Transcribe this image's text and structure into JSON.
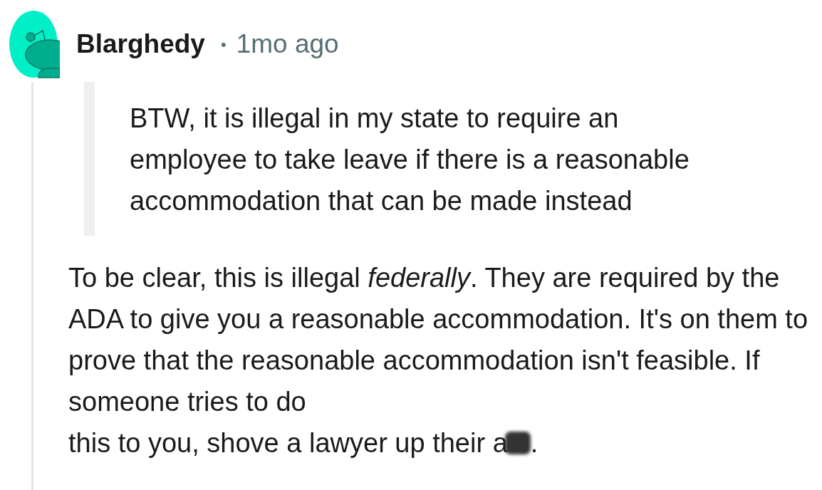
{
  "author": {
    "username": "Blarghedy",
    "separator": "•",
    "time": "1mo ago"
  },
  "quote": "BTW, it is illegal in my state to require an employee to take leave if there is a reasonable accommodation that can be made instead",
  "body": {
    "text": "To be clear, this is illegal *federally*. They are required by the ADA to give you a reasonable accommodation. It's on them to prove that the reasonable accommodation isn't feasible. If someone tries to do",
    "last_line": "this to you, shove a lawyer up their a",
    "after": "."
  }
}
